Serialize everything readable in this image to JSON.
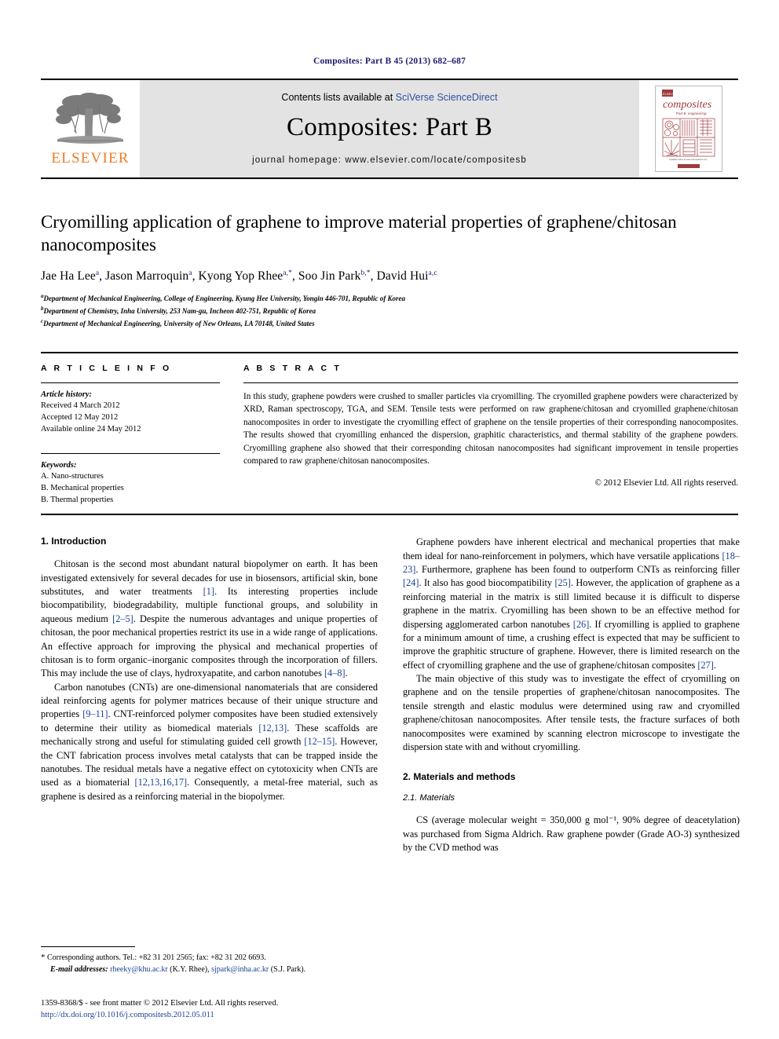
{
  "running_head": "Composites: Part B 45 (2013) 682–687",
  "masthead": {
    "publisher_name": "ELSEVIER",
    "contents_prefix": "Contents lists available at ",
    "contents_link": "SciVerse ScienceDirect",
    "journal_title": "Composites: Part B",
    "homepage": "journal homepage: www.elsevier.com/locate/compositesb",
    "cover_title": "composites",
    "cover_subtitle": "Part B: engineering"
  },
  "title_block": {
    "title": "Cryomilling application of graphene to improve material properties of graphene/chitosan nanocomposites",
    "authors": [
      {
        "name": "Jae Ha Lee",
        "sup": "a",
        "sep": ", "
      },
      {
        "name": "Jason Marroquin",
        "sup": "a",
        "sep": ", "
      },
      {
        "name": "Kyong Yop Rhee",
        "sup": "a,*",
        "sep": ", "
      },
      {
        "name": "Soo Jin Park",
        "sup": "b,*",
        "sep": ", "
      },
      {
        "name": "David Hui",
        "sup": "a,c",
        "sep": ""
      }
    ],
    "affiliations": [
      {
        "sup": "a",
        "text": "Department of Mechanical Engineering, College of Engineering, Kyung Hee University, Yongin 446-701, Republic of Korea"
      },
      {
        "sup": "b",
        "text": "Department of Chemistry, Inha University, 253 Nam-gu, Incheon 402-751, Republic of Korea"
      },
      {
        "sup": "c",
        "text": "Department of Mechanical Engineering, University of New Orleans, LA 70148, United States"
      }
    ]
  },
  "article_info": {
    "heading": "A R T I C L E   I N F O",
    "history_label": "Article history:",
    "history": [
      "Received 4 March 2012",
      "Accepted 12 May 2012",
      "Available online 24 May 2012"
    ],
    "keywords_label": "Keywords:",
    "keywords": [
      "A. Nano-structures",
      "B. Mechanical properties",
      "B. Thermal properties"
    ]
  },
  "abstract": {
    "heading": "A B S T R A C T",
    "text": "In this study, graphene powders were crushed to smaller particles via cryomilling. The cryomilled graphene powders were characterized by XRD, Raman spectroscopy, TGA, and SEM. Tensile tests were performed on raw graphene/chitosan and cryomilled graphene/chitosan nanocomposites in order to investigate the cryomilling effect of graphene on the tensile properties of their corresponding nanocomposites. The results showed that cryomilling enhanced the dispersion, graphitic characteristics, and thermal stability of the graphene powders. Cryomilling graphene also showed that their corresponding chitosan nanocomposites had significant improvement in tensile properties compared to raw graphene/chitosan nanocomposites.",
    "copyright": "© 2012 Elsevier Ltd. All rights reserved."
  },
  "body": {
    "left": {
      "section_heading": "1. Introduction",
      "paragraphs": [
        "Chitosan is the second most abundant natural biopolymer on earth. It has been investigated extensively for several decades for use in biosensors, artificial skin, bone substitutes, and water treatments [1]. Its interesting properties include biocompatibility, biodegradability, multiple functional groups, and solubility in aqueous medium [2–5]. Despite the numerous advantages and unique properties of chitosan, the poor mechanical properties restrict its use in a wide range of applications. An effective approach for improving the physical and mechanical properties of chitosan is to form organic–inorganic composites through the incorporation of fillers. This may include the use of clays, hydroxyapatite, and carbon nanotubes [4–8].",
        "Carbon nanotubes (CNTs) are one-dimensional nanomaterials that are considered ideal reinforcing agents for polymer matrices because of their unique structure and properties [9–11]. CNT-reinforced polymer composites have been studied extensively to determine their utility as biomedical materials [12,13]. These scaffolds are mechanically strong and useful for stimulating guided cell growth [12–15]. However, the CNT fabrication process involves metal catalysts that can be trapped inside the nanotubes. The residual metals have a negative effect on cytotoxicity when CNTs are used as a biomaterial [12,13,16,17]. Consequently, a metal-free material, such as graphene is desired as a reinforcing material in the biopolymer."
      ],
      "footnote": {
        "star": "*",
        "corresponding": "Corresponding authors. Tel.: +82 31 201 2565; fax: +82 31 202 6693.",
        "email_label": "E-mail addresses:",
        "email1": "rheeky@khu.ac.kr",
        "email1_who": "(K.Y. Rhee),",
        "email2": "sjpark@inha.ac.kr",
        "email2_who": "(S.J. Park)."
      }
    },
    "right": {
      "paragraphs": [
        "Graphene powders have inherent electrical and mechanical properties that make them ideal for nano-reinforcement in polymers, which have versatile applications [18–23]. Furthermore, graphene has been found to outperform CNTs as reinforcing filler [24]. It also has good biocompatibility [25]. However, the application of graphene as a reinforcing material in the matrix is still limited because it is difficult to disperse graphene in the matrix. Cryomilling has been shown to be an effective method for dispersing agglomerated carbon nanotubes [26]. If cryomilling is applied to graphene for a minimum amount of time, a crushing effect is expected that may be sufficient to improve the graphitic structure of graphene. However, there is limited research on the effect of cryomilling graphene and the use of graphene/chitosan composites [27].",
        "The main objective of this study was to investigate the effect of cryomilling on graphene and on the tensile properties of graphene/chitosan nanocomposites. The tensile strength and elastic modulus were determined using raw and cryomilled graphene/chitosan nanocomposites. After tensile tests, the fracture surfaces of both nanocomposites were examined by scanning electron microscope to investigate the dispersion state with and without cryomilling."
      ],
      "section_heading": "2. Materials and methods",
      "subsection_heading": "2.1. Materials",
      "materials_paragraph": "CS (average molecular weight = 350,000 g mol⁻¹, 90% degree of deacetylation) was purchased from Sigma Aldrich. Raw graphene powder (Grade AO-3) synthesized by the CVD method was"
    }
  },
  "page_footer": {
    "issn_line": "1359-8368/$ - see front matter © 2012 Elsevier Ltd. All rights reserved.",
    "doi": "http://dx.doi.org/10.1016/j.compositesb.2012.05.011"
  },
  "colors": {
    "running_head": "#1a1a6e",
    "link": "#1c3f94",
    "elsevier_orange": "#ec7c26",
    "masthead_gray": "#e3e3e3",
    "cover_red": "#9e3b3b"
  }
}
